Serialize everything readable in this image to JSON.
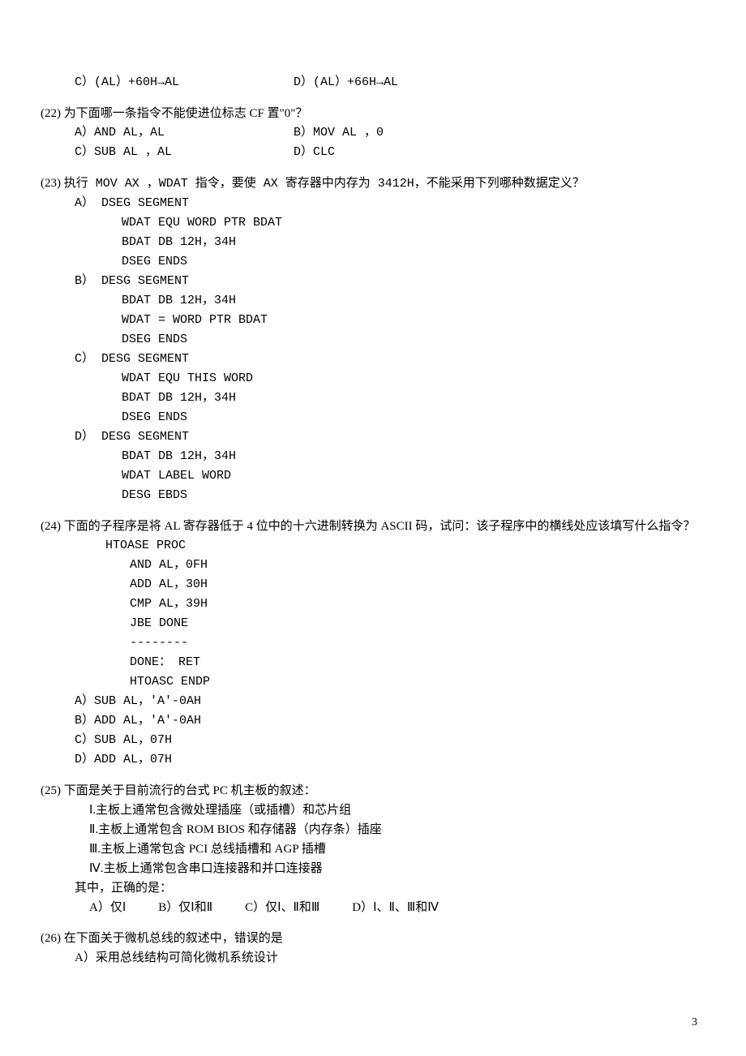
{
  "q21": {
    "optC": "C）(AL）+60H→AL",
    "optD": "D）(AL）+66H→AL"
  },
  "q22": {
    "num": "(22)",
    "text": "为下面哪一条指令不能使进位标志 CF 置\"0\"？",
    "optA": "A）AND  AL，AL",
    "optB": "B）MOV  AL  ，0",
    "optC": "C）SUB AL ，AL",
    "optD": "D）CLC"
  },
  "q23": {
    "num": "(23)",
    "text": "执行 MOV  AX ，WDAT 指令，要使 AX 寄存器中内存为 3412H，不能采用下列哪种数据定义？",
    "optA": {
      "label": "A）",
      "l1": "DSEG   SEGMENT",
      "l2": "WDAT   EQU   WORD PTR BDAT",
      "l3": "BDAT   DB    12H，34H",
      "l4": "DSEG   ENDS"
    },
    "optB": {
      "label": "B）",
      "l1": "DESG   SEGMENT",
      "l2": "BDAT   DB    12H，34H",
      "l3": "WDAT   =     WORD PTR BDAT",
      "l4": "DSEG   ENDS"
    },
    "optC": {
      "label": "C）",
      "l1": "DESG   SEGMENT",
      "l2": "WDAT   EQU   THIS WORD",
      "l3": "BDAT   DB    12H，34H",
      "l4": "DSEG   ENDS"
    },
    "optD": {
      "label": "D）",
      "l1": "DESG   SEGMENT",
      "l2": "BDAT   DB    12H，34H",
      "l3": "WDAT   LABEL WORD",
      "l4": "DESG     EBDS"
    }
  },
  "q24": {
    "num": "(24)",
    "text": "下面的子程序是将 AL 寄存器低于 4 位中的十六进制转换为 ASCII 码，试问：该子程序中的横线处应该填写什么指令？",
    "code": {
      "l1": "HTOASE     PROC",
      "l2": "AND      AL，0FH",
      "l3": "ADD      AL，30H",
      "l4": "CMP      AL，39H",
      "l5": "JBE      DONE",
      "l6": "--------",
      "l7": "DONE：   RET",
      "l8": "HTOASC    ENDP"
    },
    "optA": "A）SUB    AL，'A'-0AH",
    "optB": "B）ADD    AL，'A'-0AH",
    "optC": "C）SUB    AL，07H",
    "optD": "D）ADD    AL，07H"
  },
  "q25": {
    "num": "(25)",
    "text": "下面是关于目前流行的台式 PC 机主板的叙述：",
    "s1": "Ⅰ.主板上通常包含微处理插座（或插槽）和芯片组",
    "s2": "Ⅱ.主板上通常包含 ROM BIOS 和存储器（内存条）插座",
    "s3": "Ⅲ.主板上通常包含 PCI 总线插槽和 AGP 插槽",
    "s4": "Ⅳ.主板上通常包含串口连接器和并口连接器",
    "correct": "其中，正确的是：",
    "optA": "A）仅Ⅰ",
    "optB": "B）仅Ⅰ和Ⅱ",
    "optC": "C）仅Ⅰ、Ⅱ和Ⅲ",
    "optD": "D）Ⅰ、Ⅱ、Ⅲ和Ⅳ"
  },
  "q26": {
    "num": "(26)",
    "text": "在下面关于微机总线的叙述中，错误的是",
    "optA": "A）采用总线结构可简化微机系统设计"
  },
  "pageNumber": "3"
}
